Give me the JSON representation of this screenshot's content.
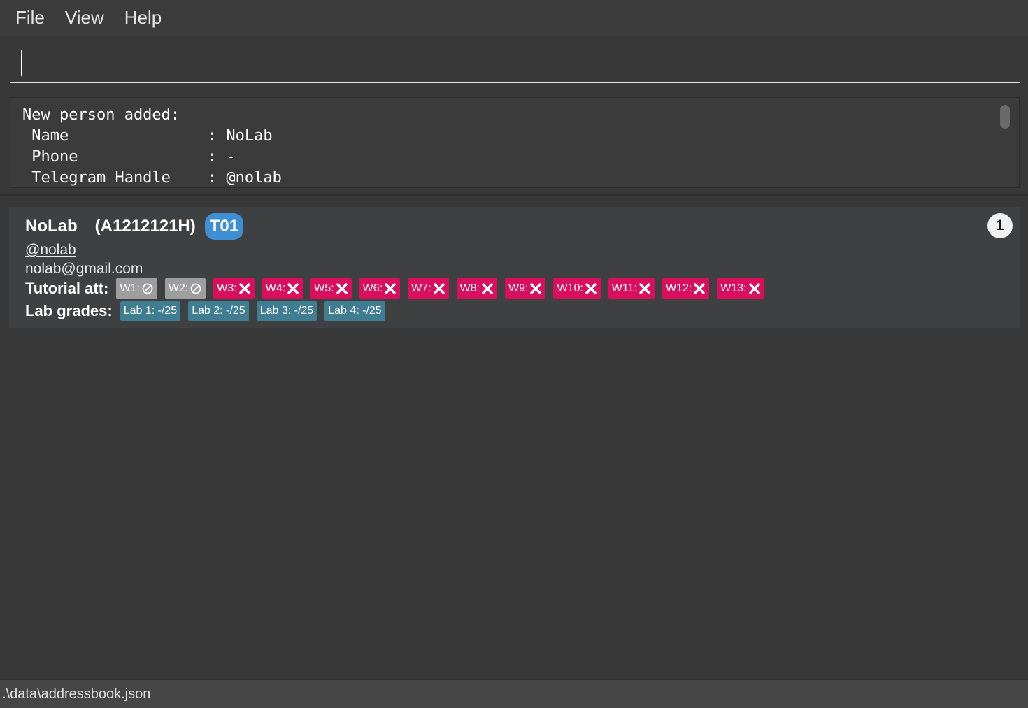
{
  "menu": {
    "file": "File",
    "view": "View",
    "help": "Help"
  },
  "command": {
    "value": ""
  },
  "result": {
    "lines": [
      "New person added:",
      " Name               : NoLab",
      " Phone              : -",
      " Telegram Handle    : @nolab"
    ]
  },
  "person": {
    "index": "1",
    "name": "NoLab",
    "student_id": "(A1212121H)",
    "group": "T01",
    "telegram": "@nolab",
    "email": "nolab@gmail.com",
    "attendance_label": "Tutorial att:",
    "attendance": [
      {
        "label": "W1:",
        "status": "not-applicable",
        "icon": "no-entry-icon"
      },
      {
        "label": "W2:",
        "status": "not-applicable",
        "icon": "no-entry-icon"
      },
      {
        "label": "W3:",
        "status": "absent",
        "icon": "cross-icon"
      },
      {
        "label": "W4:",
        "status": "absent",
        "icon": "cross-icon"
      },
      {
        "label": "W5:",
        "status": "absent",
        "icon": "cross-icon"
      },
      {
        "label": "W6:",
        "status": "absent",
        "icon": "cross-icon"
      },
      {
        "label": "W7:",
        "status": "absent",
        "icon": "cross-icon"
      },
      {
        "label": "W8:",
        "status": "absent",
        "icon": "cross-icon"
      },
      {
        "label": "W9:",
        "status": "absent",
        "icon": "cross-icon"
      },
      {
        "label": "W10:",
        "status": "absent",
        "icon": "cross-icon"
      },
      {
        "label": "W11:",
        "status": "absent",
        "icon": "cross-icon"
      },
      {
        "label": "W12:",
        "status": "absent",
        "icon": "cross-icon"
      },
      {
        "label": "W13:",
        "status": "absent",
        "icon": "cross-icon"
      }
    ],
    "lab_label": "Lab grades:",
    "labs": [
      "Lab 1: -/25",
      "Lab 2: -/25",
      "Lab 3: -/25",
      "Lab 4: -/25"
    ]
  },
  "status": {
    "path": ".\\data\\addressbook.json"
  },
  "colors": {
    "background": "#383838",
    "group_badge": "#3e8fd4",
    "absent_tag": "#d90f5e",
    "not_applicable_tag": "#9e9e9e",
    "lab_tag": "#3f7d93"
  }
}
